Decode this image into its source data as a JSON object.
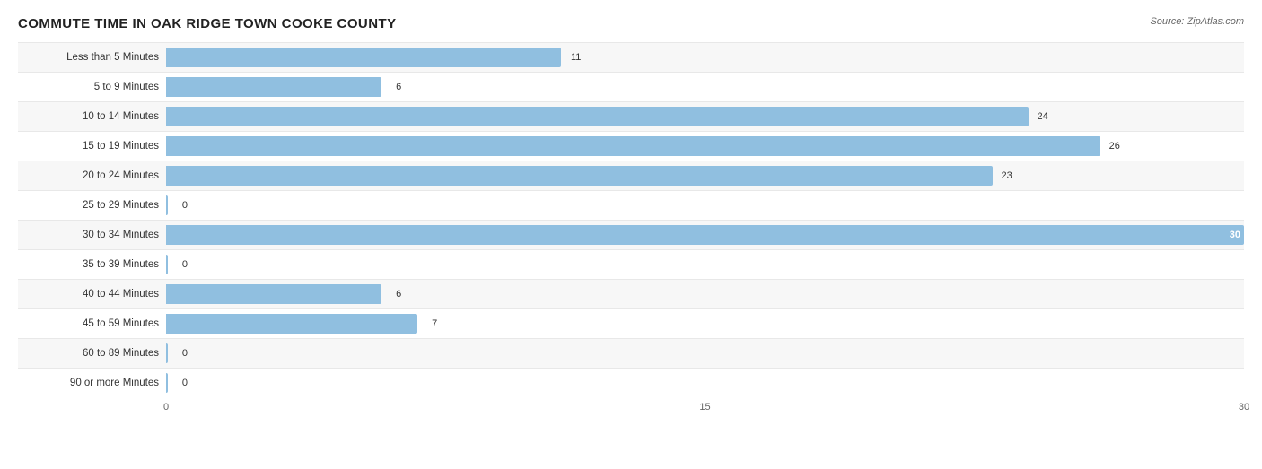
{
  "title": "COMMUTE TIME IN OAK RIDGE TOWN COOKE COUNTY",
  "source": "Source: ZipAtlas.com",
  "maxValue": 30,
  "chartWidth": 1180,
  "bars": [
    {
      "label": "Less than 5 Minutes",
      "value": 11
    },
    {
      "label": "5 to 9 Minutes",
      "value": 6
    },
    {
      "label": "10 to 14 Minutes",
      "value": 24
    },
    {
      "label": "15 to 19 Minutes",
      "value": 26
    },
    {
      "label": "20 to 24 Minutes",
      "value": 23
    },
    {
      "label": "25 to 29 Minutes",
      "value": 0
    },
    {
      "label": "30 to 34 Minutes",
      "value": 30
    },
    {
      "label": "35 to 39 Minutes",
      "value": 0
    },
    {
      "label": "40 to 44 Minutes",
      "value": 6
    },
    {
      "label": "45 to 59 Minutes",
      "value": 7
    },
    {
      "label": "60 to 89 Minutes",
      "value": 0
    },
    {
      "label": "90 or more Minutes",
      "value": 0
    }
  ],
  "xAxis": {
    "ticks": [
      {
        "label": "0",
        "pct": 0
      },
      {
        "label": "15",
        "pct": 50
      },
      {
        "label": "30",
        "pct": 100
      }
    ]
  }
}
